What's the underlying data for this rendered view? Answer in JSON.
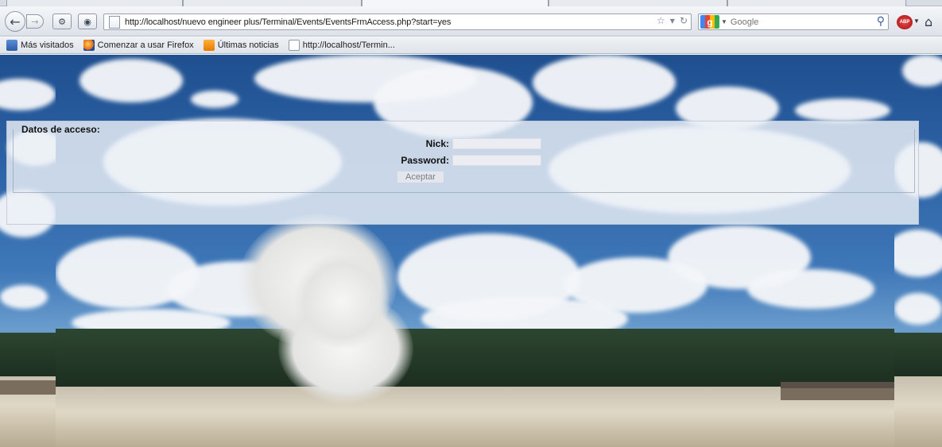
{
  "browser": {
    "url": "http://localhost/nuevo engineer plus/Terminal/Events/EventsFrmAccess.php?start=yes",
    "search_placeholder": "Google",
    "abp_label": "ABP"
  },
  "bookmarks": [
    {
      "label": "Más visitados",
      "icon": "star-folder-icon"
    },
    {
      "label": "Comenzar a usar Firefox",
      "icon": "firefox-icon"
    },
    {
      "label": "Últimas noticias",
      "icon": "rss-icon"
    },
    {
      "label": "http://localhost/Termin...",
      "icon": "page-icon"
    }
  ],
  "form": {
    "title": "Datos de acceso:",
    "nick_label": "Nick:",
    "nick_value": "",
    "password_label": "Password:",
    "password_value": "",
    "submit_label": "Aceptar"
  }
}
